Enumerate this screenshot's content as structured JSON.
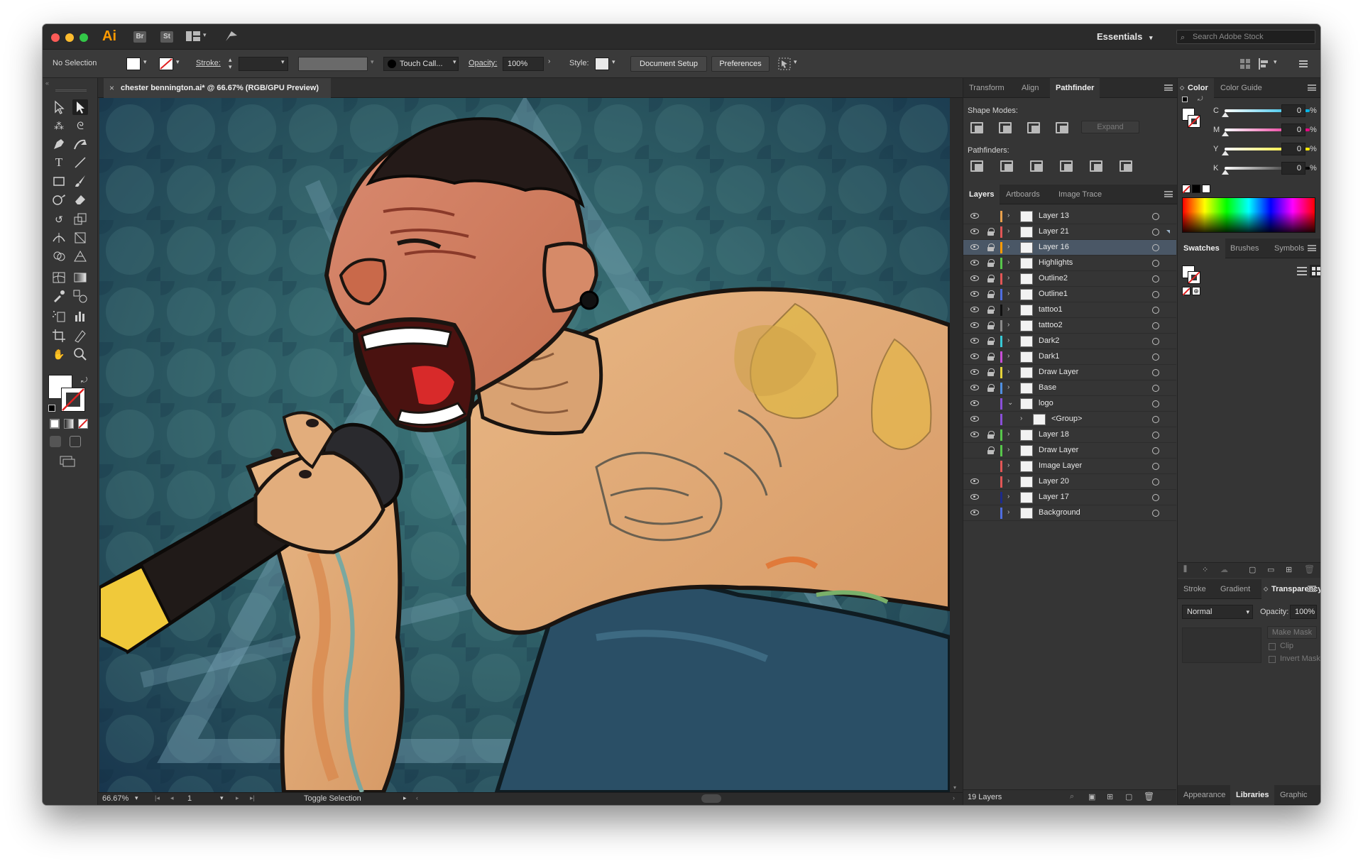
{
  "app": {
    "logo": "Ai",
    "bridge_badge": "Br",
    "stock_badge": "St",
    "workspace": "Essentials",
    "search_placeholder": "Search Adobe Stock"
  },
  "control_bar": {
    "selection": "No Selection",
    "stroke_label": "Stroke:",
    "brush": "Touch Call...",
    "opacity_label": "Opacity:",
    "opacity_value": "100%",
    "style_label": "Style:",
    "document_setup": "Document Setup",
    "preferences": "Preferences"
  },
  "document": {
    "tab_title": "chester bennington.ai* @ 66.67% (RGB/GPU Preview)",
    "zoom": "66.67%",
    "artboard": "1",
    "status": "Toggle Selection"
  },
  "pathfinder_panel": {
    "tabs": [
      "Transform",
      "Align",
      "Pathfinder"
    ],
    "active": "Pathfinder",
    "shape_modes": "Shape Modes:",
    "expand": "Expand",
    "pathfinders": "Pathfinders:"
  },
  "layers_panel": {
    "tabs": [
      "Layers",
      "Artboards",
      "Image Trace"
    ],
    "active": "Layers",
    "footer": "19 Layers",
    "layers": [
      {
        "name": "Layer 13",
        "color": "#e8a04c",
        "visible": true,
        "locked": false,
        "indent": 0,
        "expanded": false
      },
      {
        "name": "Layer 21",
        "color": "#e25656",
        "visible": true,
        "locked": true,
        "indent": 0,
        "expanded": false
      },
      {
        "name": "Layer 16",
        "color": "#ff9a00",
        "visible": true,
        "locked": true,
        "indent": 0,
        "expanded": false,
        "selected": true
      },
      {
        "name": "Highlights",
        "color": "#57c64b",
        "visible": true,
        "locked": true,
        "indent": 0,
        "expanded": false
      },
      {
        "name": "Outline2",
        "color": "#e25656",
        "visible": true,
        "locked": true,
        "indent": 0,
        "expanded": false
      },
      {
        "name": "Outline1",
        "color": "#4f6de0",
        "visible": true,
        "locked": true,
        "indent": 0,
        "expanded": false
      },
      {
        "name": "tattoo1",
        "color": "#111111",
        "visible": true,
        "locked": true,
        "indent": 0,
        "expanded": false
      },
      {
        "name": "tattoo2",
        "color": "#8a8a8a",
        "visible": true,
        "locked": true,
        "indent": 0,
        "expanded": false
      },
      {
        "name": "Dark2",
        "color": "#38c9d6",
        "visible": true,
        "locked": true,
        "indent": 0,
        "expanded": false
      },
      {
        "name": "Dark1",
        "color": "#c84fd8",
        "visible": true,
        "locked": true,
        "indent": 0,
        "expanded": false
      },
      {
        "name": "Draw Layer",
        "color": "#e6d33a",
        "visible": true,
        "locked": true,
        "indent": 0,
        "expanded": false
      },
      {
        "name": "Base",
        "color": "#4f8fe0",
        "visible": true,
        "locked": true,
        "indent": 0,
        "expanded": false
      },
      {
        "name": "logo",
        "color": "#8a4fd8",
        "visible": true,
        "locked": false,
        "indent": 0,
        "expanded": true
      },
      {
        "name": "<Group>",
        "color": "#8a4fd8",
        "visible": true,
        "locked": false,
        "indent": 1,
        "expanded": false
      },
      {
        "name": "Layer 18",
        "color": "#57c64b",
        "visible": true,
        "locked": true,
        "indent": 0,
        "expanded": false
      },
      {
        "name": "Draw Layer",
        "color": "#57c64b",
        "visible": false,
        "locked": true,
        "indent": 0,
        "expanded": false
      },
      {
        "name": "Image Layer",
        "color": "#e25656",
        "visible": false,
        "locked": false,
        "indent": 0,
        "expanded": false
      },
      {
        "name": "Layer 20",
        "color": "#e25656",
        "visible": true,
        "locked": false,
        "indent": 0,
        "expanded": false
      },
      {
        "name": "Layer 17",
        "color": "#1c2a8a",
        "visible": true,
        "locked": false,
        "indent": 0,
        "expanded": false
      },
      {
        "name": "Background",
        "color": "#4f6de0",
        "visible": true,
        "locked": false,
        "indent": 0,
        "expanded": false
      }
    ]
  },
  "color_panel": {
    "tabs": [
      "Color",
      "Color Guide"
    ],
    "active": "Color",
    "channels": [
      {
        "label": "C",
        "value": "0",
        "color": "#00b2e5"
      },
      {
        "label": "M",
        "value": "0",
        "color": "#e5007f"
      },
      {
        "label": "Y",
        "value": "0",
        "color": "#ffe800"
      },
      {
        "label": "K",
        "value": "0",
        "color": "#000000"
      }
    ],
    "percent": "%"
  },
  "swatches_panel": {
    "tabs": [
      "Swatches",
      "Brushes",
      "Symbols"
    ],
    "active": "Swatches"
  },
  "transparency_panel": {
    "tabs": [
      "Stroke",
      "Gradient",
      "Transparency"
    ],
    "active": "Transparency",
    "blend_mode": "Normal",
    "opacity_label": "Opacity:",
    "opacity_value": "100%",
    "make_mask": "Make Mask",
    "clip": "Clip",
    "invert_mask": "Invert Mask"
  },
  "bottom_tabs": {
    "tabs": [
      "Appearance",
      "Libraries",
      "Graphic Styl"
    ],
    "active": "Libraries"
  },
  "colors": {
    "accent": "#ff9a00",
    "selected_row": "#4a5766"
  }
}
